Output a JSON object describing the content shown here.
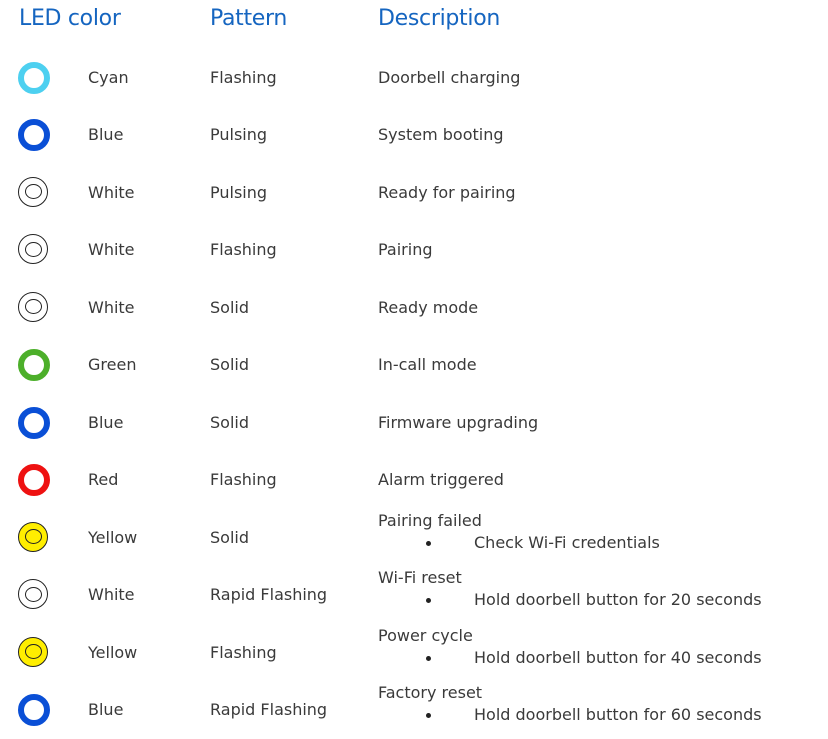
{
  "headers": {
    "led_color": "LED color",
    "pattern": "Pattern",
    "description": "Description"
  },
  "rows": [
    {
      "color": "Cyan",
      "pattern": "Flashing",
      "description": "Doorbell charging",
      "led_hex": "#4dd0f0",
      "style": "solid"
    },
    {
      "color": "Blue",
      "pattern": "Pulsing",
      "description": "System booting",
      "led_hex": "#0a4fd6",
      "style": "solid"
    },
    {
      "color": "White",
      "pattern": "Pulsing",
      "description": "Ready for pairing",
      "led_hex": "#ffffff",
      "style": "outlined"
    },
    {
      "color": "White",
      "pattern": "Flashing",
      "description": "Pairing",
      "led_hex": "#ffffff",
      "style": "outlined"
    },
    {
      "color": "White",
      "pattern": "Solid",
      "description": "Ready mode",
      "led_hex": "#ffffff",
      "style": "outlined"
    },
    {
      "color": "Green",
      "pattern": "Solid",
      "description": "In-call mode",
      "led_hex": "#4caf2a",
      "style": "solid"
    },
    {
      "color": "Blue",
      "pattern": "Solid",
      "description": "Firmware upgrading",
      "led_hex": "#0a4fd6",
      "style": "solid"
    },
    {
      "color": "Red",
      "pattern": "Flashing",
      "description": "Alarm triggered",
      "led_hex": "#ee1111",
      "style": "solid"
    },
    {
      "color": "Yellow",
      "pattern": "Solid",
      "description": "Pairing failed",
      "bullet": "Check Wi-Fi credentials",
      "led_hex": "#ffee00",
      "style": "yellowring"
    },
    {
      "color": "White",
      "pattern": "Rapid Flashing",
      "description": "Wi-Fi reset",
      "bullet": "Hold doorbell button for 20 seconds",
      "led_hex": "#ffffff",
      "style": "outlined"
    },
    {
      "color": "Yellow",
      "pattern": "Flashing",
      "description": "Power cycle",
      "bullet": "Hold doorbell button for 40 seconds",
      "led_hex": "#ffee00",
      "style": "yellowring"
    },
    {
      "color": "Blue",
      "pattern": "Rapid Flashing",
      "description": "Factory reset",
      "bullet": "Hold doorbell button for 60 seconds",
      "led_hex": "#0a4fd6",
      "style": "solid"
    }
  ]
}
